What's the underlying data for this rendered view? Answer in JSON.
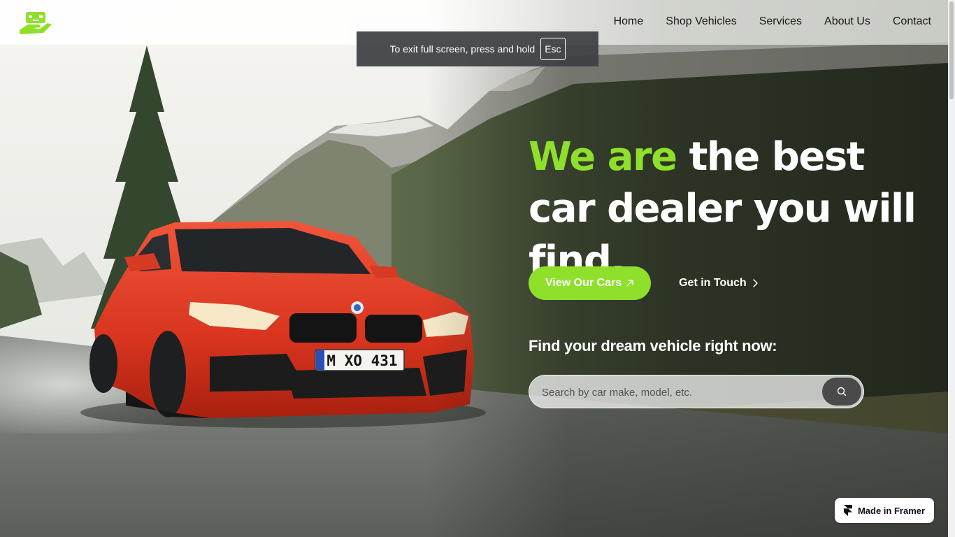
{
  "brand": {
    "accent_color": "#8ee02a",
    "logo_icon": "car-in-hand-icon"
  },
  "nav": {
    "items": [
      {
        "label": "Home"
      },
      {
        "label": "Shop Vehicles"
      },
      {
        "label": "Services"
      },
      {
        "label": "About Us"
      },
      {
        "label": "Contact"
      }
    ]
  },
  "fullscreen_toast": {
    "message": "To exit full screen, press and hold",
    "key": "Esc"
  },
  "hero": {
    "headline_accent": "We are",
    "headline_rest": " the best car dealer you will find.",
    "primary_cta": "View Our Cars",
    "primary_cta_icon": "arrow-up-right-icon",
    "secondary_cta": "Get in Touch",
    "secondary_cta_icon": "chevron-right-icon",
    "subhead": "Find your dream vehicle right now:",
    "search": {
      "placeholder": "Search by car make, model, etc.",
      "value": "",
      "button_icon": "search-icon"
    },
    "background_image": "red-sports-car-on-mountain-road",
    "license_plate": "M XO 431"
  },
  "badge": {
    "label": "Made in Framer",
    "icon": "framer-logo-icon"
  }
}
